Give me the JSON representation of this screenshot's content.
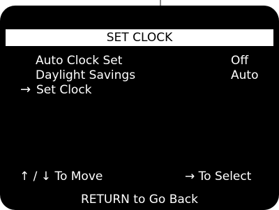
{
  "menu": {
    "title": "SET CLOCK",
    "items": [
      {
        "label": "Auto Clock Set",
        "value": "Off",
        "selected": false
      },
      {
        "label": "Daylight Savings",
        "value": "Auto",
        "selected": false
      },
      {
        "label": "Set Clock",
        "value": "",
        "selected": true
      }
    ],
    "cursor_icon": "→"
  },
  "footer": {
    "up_icon": "↑",
    "separator": "/",
    "down_icon": "↓",
    "move_label": "To Move",
    "select_icon": "→",
    "select_label": "To Select",
    "return_hint": "RETURN to Go Back"
  },
  "colors": {
    "screen_bg": "#000000",
    "text": "#ffffff",
    "title_bar_bg": "#ffffff",
    "title_text": "#000000"
  }
}
